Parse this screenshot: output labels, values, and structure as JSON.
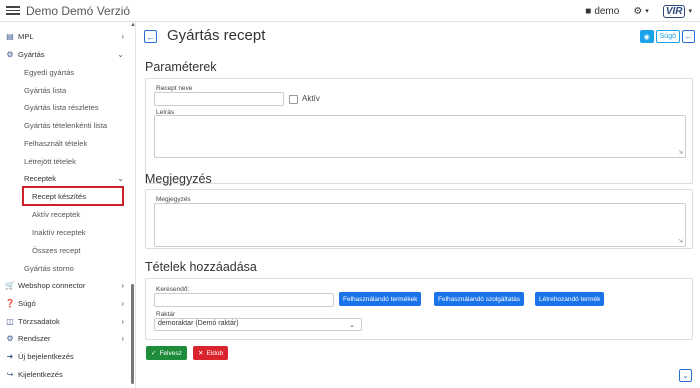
{
  "app": {
    "title": "Demo Demó Verzió",
    "user": "demo",
    "logo_text": "VIR"
  },
  "icons": {
    "menu": "hamburger-icon",
    "user": "user-icon",
    "settings": "gear-icon"
  },
  "sidebar": {
    "items": [
      {
        "label": "MPL",
        "icon": "chart-icon",
        "chevron": "›"
      },
      {
        "label": "Gyártás",
        "icon": "cogs-icon",
        "chevron": "⌄"
      },
      {
        "label": "Egyedi gyártás"
      },
      {
        "label": "Gyártás lista"
      },
      {
        "label": "Gyártás lista részletes"
      },
      {
        "label": "Gyártás tételenkénti lista"
      },
      {
        "label": "Felhasznált tételek"
      },
      {
        "label": "Létrejött tételek"
      },
      {
        "label": "Receptek",
        "chevron": "⌄"
      },
      {
        "label": "Recept készítés"
      },
      {
        "label": "Aktív receptek"
      },
      {
        "label": "Inaktív receptek"
      },
      {
        "label": "Összes recept"
      },
      {
        "label": "Gyártás storno"
      },
      {
        "label": "Webshop connector",
        "icon": "cart-icon",
        "chevron": "›"
      },
      {
        "label": "Súgó",
        "icon": "question-icon",
        "chevron": "›"
      },
      {
        "label": "Törzsadatok",
        "icon": "database-icon",
        "chevron": "›"
      },
      {
        "label": "Rendszer",
        "icon": "cogs-icon",
        "chevron": "›"
      },
      {
        "label": "Új bejelentkezés",
        "icon": "login-icon"
      },
      {
        "label": "Kijelentkezés",
        "icon": "logout-icon"
      }
    ]
  },
  "main": {
    "title": "Gyártás recept",
    "help_label": "Súgó",
    "sections": {
      "params": "Paraméterek",
      "comment": "Megjegyzés",
      "items": "Tételek hozzáadása"
    },
    "fields": {
      "recipe_name_label": "Recept neve",
      "active_label": "Aktív",
      "description_label": "Leírás",
      "comment_label": "Megjegyzés",
      "search_label": "Keresendő:",
      "warehouse_label": "Raktár",
      "warehouse_value": "demoraktar (Demó raktár)"
    },
    "buttons": {
      "used_products": "Felhasználandó termékek",
      "used_services": "Felhasználandó szolgáltatás",
      "created_product": "Létrehozandó termék",
      "save": "Felvesz",
      "cancel": "Eldob"
    }
  }
}
